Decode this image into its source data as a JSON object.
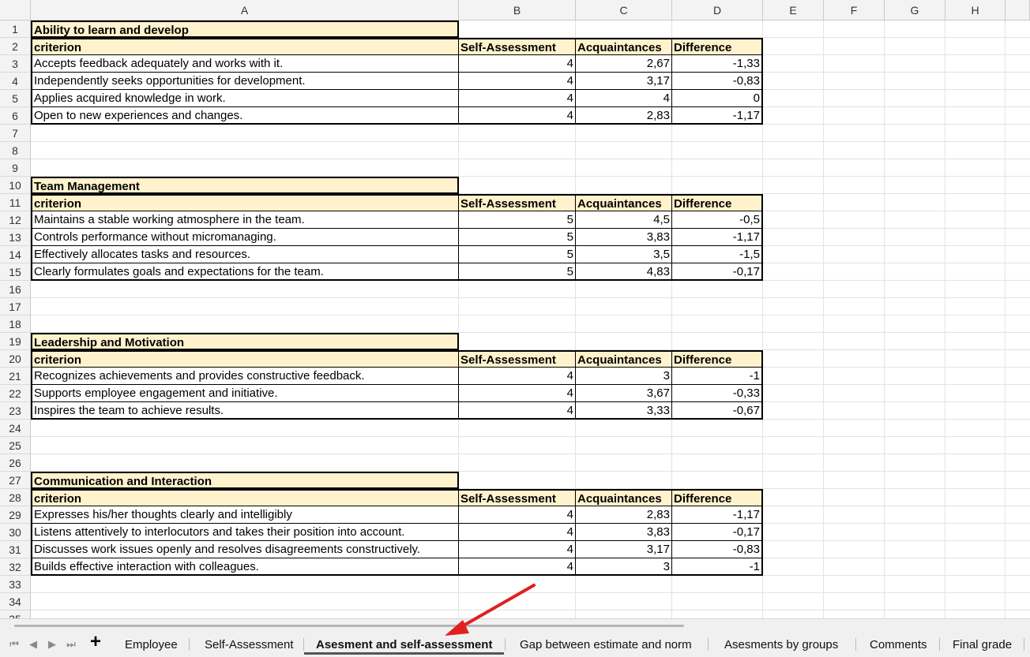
{
  "columns": [
    "A",
    "B",
    "C",
    "D",
    "E",
    "F",
    "G",
    "H"
  ],
  "rows": [
    "1",
    "2",
    "3",
    "4",
    "5",
    "6",
    "7",
    "8",
    "9",
    "10",
    "11",
    "12",
    "13",
    "14",
    "15",
    "16",
    "17",
    "18",
    "19",
    "20",
    "21",
    "22",
    "23",
    "24",
    "25",
    "26",
    "27",
    "28",
    "29",
    "30",
    "31",
    "32",
    "33",
    "34",
    "35"
  ],
  "headers": {
    "criterion": "criterion",
    "self": "Self-Assessment",
    "acq": "Acquaintances",
    "diff": "Difference"
  },
  "sections": [
    {
      "title": "Ability to learn and develop",
      "rows": [
        {
          "criterion": "Accepts feedback adequately and works with it.",
          "self": "4",
          "acq": "2,67",
          "diff": "-1,33"
        },
        {
          "criterion": "Independently seeks opportunities for development.",
          "self": "4",
          "acq": "3,17",
          "diff": "-0,83"
        },
        {
          "criterion": "Applies acquired knowledge in work.",
          "self": "4",
          "acq": "4",
          "diff": "0"
        },
        {
          "criterion": "Open to new experiences and changes.",
          "self": "4",
          "acq": "2,83",
          "diff": "-1,17"
        }
      ]
    },
    {
      "title": "Team Management",
      "rows": [
        {
          "criterion": "Maintains a stable working atmosphere in the team.",
          "self": "5",
          "acq": "4,5",
          "diff": "-0,5"
        },
        {
          "criterion": "Controls performance without micromanaging.",
          "self": "5",
          "acq": "3,83",
          "diff": "-1,17"
        },
        {
          "criterion": "Effectively allocates tasks and resources.",
          "self": "5",
          "acq": "3,5",
          "diff": "-1,5"
        },
        {
          "criterion": "Clearly formulates goals and expectations for the team.",
          "self": "5",
          "acq": "4,83",
          "diff": "-0,17"
        }
      ]
    },
    {
      "title": "Leadership and Motivation",
      "rows": [
        {
          "criterion": "Recognizes achievements and provides constructive feedback.",
          "self": "4",
          "acq": "3",
          "diff": "-1"
        },
        {
          "criterion": "Supports employee engagement and initiative.",
          "self": "4",
          "acq": "3,67",
          "diff": "-0,33"
        },
        {
          "criterion": "Inspires the team to achieve results.",
          "self": "4",
          "acq": "3,33",
          "diff": "-0,67"
        }
      ]
    },
    {
      "title": "Communication and Interaction",
      "rows": [
        {
          "criterion": "Expresses his/her thoughts clearly and intelligibly",
          "self": "4",
          "acq": "2,83",
          "diff": "-1,17"
        },
        {
          "criterion": "Listens attentively to interlocutors and takes their position into account.",
          "self": "4",
          "acq": "3,83",
          "diff": "-0,17"
        },
        {
          "criterion": "Discusses work issues openly and resolves disagreements constructively.",
          "self": "4",
          "acq": "3,17",
          "diff": "-0,83"
        },
        {
          "criterion": "Builds effective interaction with colleagues.",
          "self": "4",
          "acq": "3",
          "diff": "-1"
        }
      ]
    }
  ],
  "tabs": [
    {
      "label": "Employee",
      "active": false
    },
    {
      "label": "Self-Assessment",
      "active": false
    },
    {
      "label": "Asesment and self-assessment",
      "active": true
    },
    {
      "label": "Gap between estimate and norm",
      "active": false
    },
    {
      "label": "Asesments by groups",
      "active": false
    },
    {
      "label": "Comments",
      "active": false
    },
    {
      "label": "Final grade",
      "active": false
    }
  ],
  "nav": {
    "first": "⏮",
    "prev": "◀",
    "next": "▶",
    "last": "⏭",
    "add": "+"
  },
  "icons": {
    "arrow": "red-arrow-annotation-icon"
  },
  "colors": {
    "header_fill": "#fff2cc",
    "arrow": "#e02020"
  }
}
